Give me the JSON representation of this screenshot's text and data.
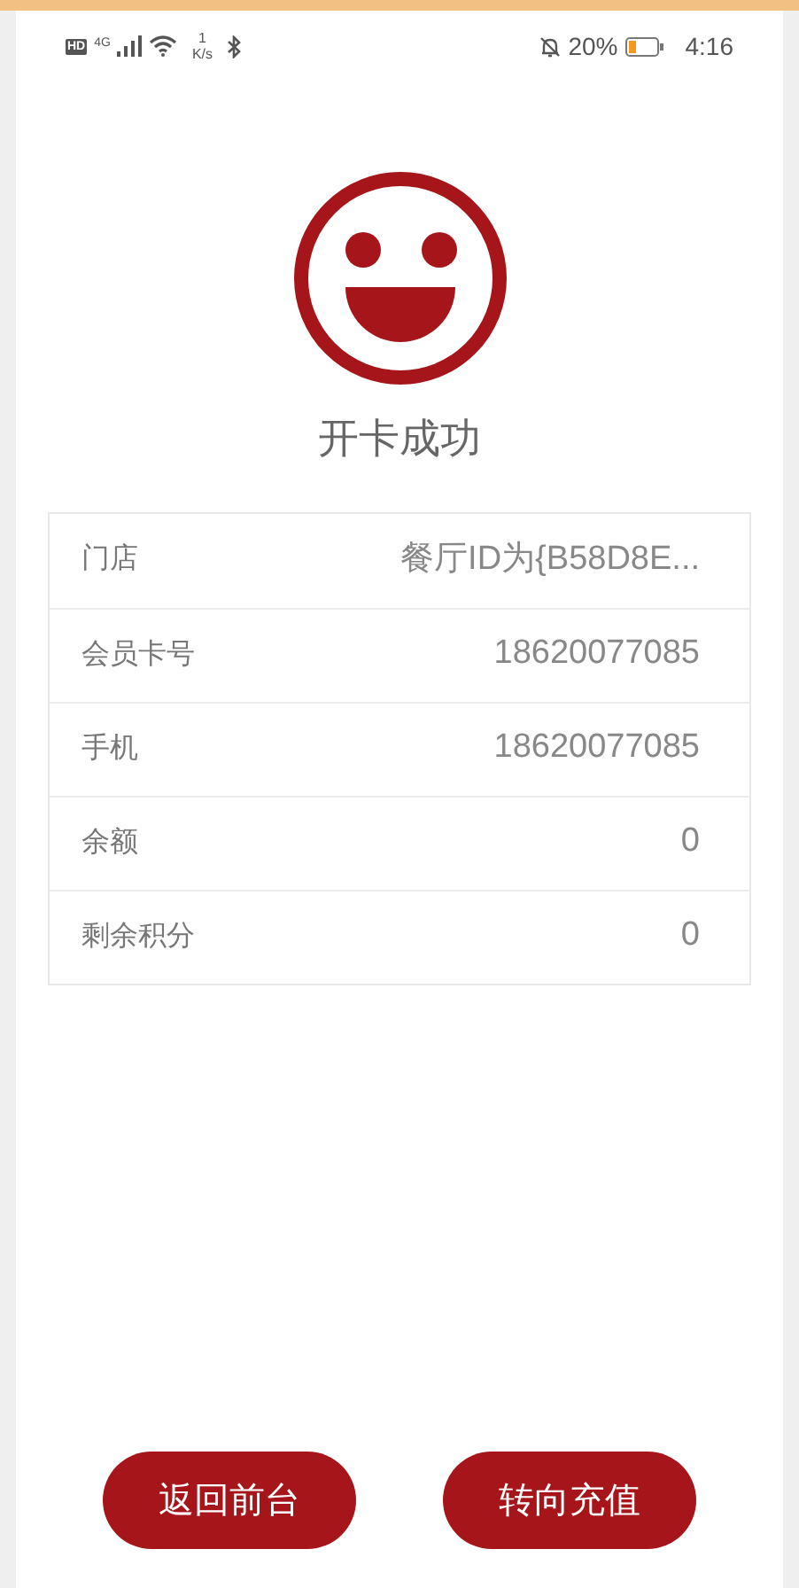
{
  "status_bar": {
    "hd": "HD",
    "network": "4G",
    "speed_value": "1",
    "speed_unit": "K/s",
    "battery_percent": "20%",
    "time": "4:16"
  },
  "result": {
    "title": "开卡成功"
  },
  "details": [
    {
      "label": "门店",
      "value": "餐厅ID为{B58D8E..."
    },
    {
      "label": "会员卡号",
      "value": "18620077085"
    },
    {
      "label": "手机",
      "value": "18620077085"
    },
    {
      "label": "余额",
      "value": "0"
    },
    {
      "label": "剩余积分",
      "value": "0"
    }
  ],
  "buttons": [
    {
      "label": "返回前台"
    },
    {
      "label": "转向充值"
    }
  ]
}
